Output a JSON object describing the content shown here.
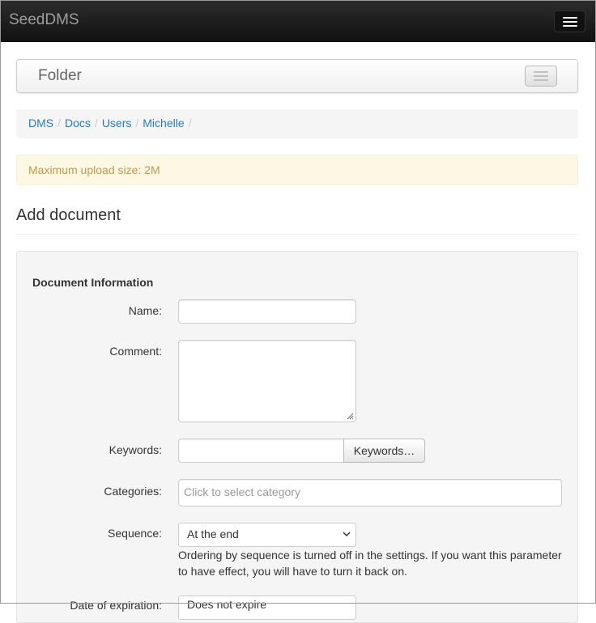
{
  "app": {
    "brand": "SeedDMS"
  },
  "folder_bar": {
    "title": "Folder"
  },
  "breadcrumb": {
    "items": [
      "DMS",
      "Docs",
      "Users",
      "Michelle"
    ],
    "separator": "/"
  },
  "alert": {
    "text": "Maximum upload size: 2M"
  },
  "page": {
    "title": "Add document"
  },
  "form": {
    "section_title": "Document Information",
    "name_label": "Name:",
    "name_value": "",
    "comment_label": "Comment:",
    "comment_value": "",
    "keywords_label": "Keywords:",
    "keywords_value": "",
    "keywords_button": "Keywords…",
    "categories_label": "Categories:",
    "categories_placeholder": "Click to select category",
    "sequence_label": "Sequence:",
    "sequence_value": "At the end",
    "sequence_help": "Ordering by sequence is turned off in the settings. If you want this parameter to have effect, you will have to turn it back on.",
    "next_label": "Date of expiration:",
    "next_value": "Does not expire"
  },
  "colors": {
    "link": "#2a7ab8",
    "alert_bg": "#fcf8e3",
    "alert_text": "#c09853",
    "navbar": "#1b1b1b"
  }
}
